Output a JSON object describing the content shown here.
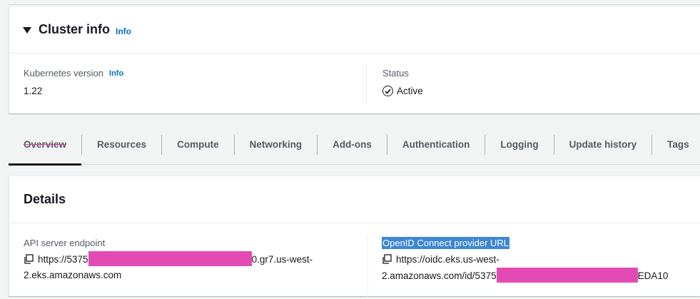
{
  "cluster_info": {
    "title": "Cluster info",
    "info_label": "Info",
    "kubernetes_version_label": "Kubernetes version",
    "kubernetes_version_info": "Info",
    "kubernetes_version_value": "1.22",
    "status_label": "Status",
    "status_value": "Active"
  },
  "tabs": [
    {
      "label": "Overview",
      "active": true
    },
    {
      "label": "Resources"
    },
    {
      "label": "Compute"
    },
    {
      "label": "Networking"
    },
    {
      "label": "Add-ons"
    },
    {
      "label": "Authentication"
    },
    {
      "label": "Logging"
    },
    {
      "label": "Update history"
    },
    {
      "label": "Tags"
    }
  ],
  "details": {
    "title": "Details",
    "api_endpoint_label": "API server endpoint",
    "api_endpoint_prefix": "https://5375",
    "api_endpoint_suffix": "0.gr7.us-west-",
    "api_endpoint_line2": "2.eks.amazonaws.com",
    "oidc_label": "OpenID Connect provider URL",
    "oidc_line1": "https://oidc.eks.us-west-",
    "oidc_line2_prefix": "2.amazonaws.com/id/5375",
    "oidc_line2_suffix": "EDA10"
  },
  "colors": {
    "accent_link": "#0073bb",
    "redaction": "#e44ab4",
    "selection": "#3c87d3"
  },
  "icons": [
    "caret-down-icon",
    "status-check-icon",
    "copy-icon"
  ]
}
